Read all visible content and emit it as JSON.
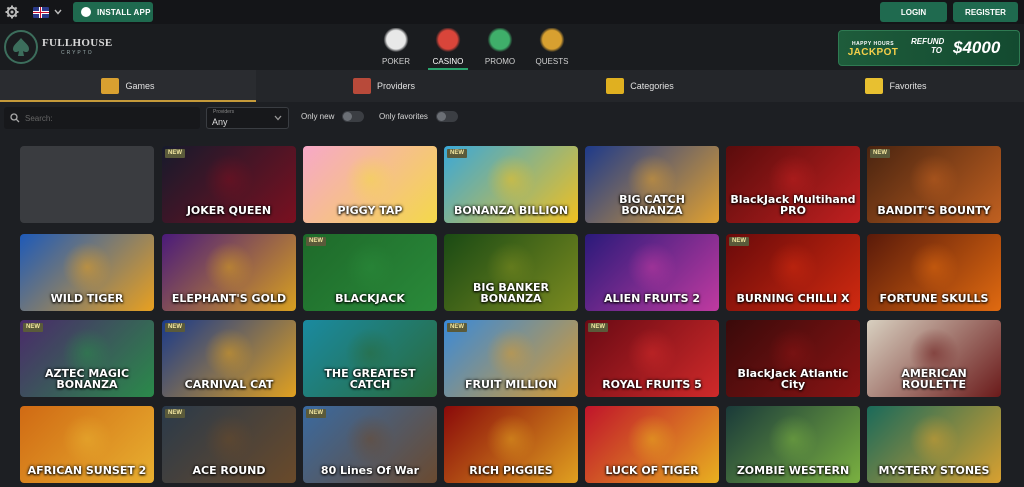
{
  "topbar": {
    "install_label": "INSTALL APP",
    "login_label": "LOGIN",
    "register_label": "REGISTER"
  },
  "logo": {
    "name": "FULLHOUSE",
    "sub": "CRYPTO"
  },
  "nav": [
    {
      "label": "POKER",
      "active": false,
      "color": "#e8e8e8"
    },
    {
      "label": "CASINO",
      "active": true,
      "color": "#d9453a"
    },
    {
      "label": "PROMO",
      "active": false,
      "color": "#3fae6a"
    },
    {
      "label": "QUESTS",
      "active": false,
      "color": "#d8a030"
    }
  ],
  "jackpot": {
    "small": "HAPPY HOURS",
    "big": "JACKPOT",
    "refund": "REFUND",
    "to": "TO",
    "amount": "$4000"
  },
  "tabs": [
    {
      "label": "Games",
      "active": true,
      "icon_color": "#d8a030"
    },
    {
      "label": "Providers",
      "active": false,
      "icon_color": "#b84a3a"
    },
    {
      "label": "Categories",
      "active": false,
      "icon_color": "#e0b020"
    },
    {
      "label": "Favorites",
      "active": false,
      "icon_color": "#e8c030"
    }
  ],
  "filters": {
    "search_placeholder": "Search:",
    "provider_label": "Providers",
    "provider_value": "Any",
    "only_new_label": "Only new",
    "only_favorites_label": "Only favorites"
  },
  "badge_text": "NEW",
  "games": [
    {
      "title": "",
      "is_new": false,
      "bg1": "#3a3c40",
      "bg2": "#3a3c40"
    },
    {
      "title": "JOKER QUEEN",
      "is_new": true,
      "bg1": "#161a2c",
      "bg2": "#7a1020"
    },
    {
      "title": "PIGGY TAP",
      "is_new": false,
      "bg1": "#f7a8c8",
      "bg2": "#f4d84a"
    },
    {
      "title": "BONANZA BILLION",
      "is_new": true,
      "bg1": "#3aa8d8",
      "bg2": "#f0c020"
    },
    {
      "title": "BIG CATCH BONANZA",
      "is_new": false,
      "bg1": "#1e3a8a",
      "bg2": "#e0a030"
    },
    {
      "title": "BlackJack Multihand PRO",
      "is_new": false,
      "bg1": "#5a0c0c",
      "bg2": "#c02020"
    },
    {
      "title": "BANDIT'S BOUNTY",
      "is_new": true,
      "bg1": "#4a2410",
      "bg2": "#c06020"
    },
    {
      "title": "WILD TIGER",
      "is_new": false,
      "bg1": "#1e5ab8",
      "bg2": "#e8a020"
    },
    {
      "title": "ELEPHANT'S GOLD",
      "is_new": false,
      "bg1": "#4a1a7a",
      "bg2": "#d8a020"
    },
    {
      "title": "BLACKJACK",
      "is_new": true,
      "bg1": "#1e6a2a",
      "bg2": "#2a8a3a"
    },
    {
      "title": "BIG BANKER BONANZA",
      "is_new": false,
      "bg1": "#1a4a14",
      "bg2": "#7a8a20"
    },
    {
      "title": "ALIEN FRUITS 2",
      "is_new": false,
      "bg1": "#2a1a7a",
      "bg2": "#c03aa0"
    },
    {
      "title": "BURNING CHILLI X",
      "is_new": true,
      "bg1": "#6a0a0a",
      "bg2": "#d02a10"
    },
    {
      "title": "FORTUNE SKULLS",
      "is_new": false,
      "bg1": "#5a1a0a",
      "bg2": "#e06a10"
    },
    {
      "title": "AZTEC MAGIC BONANZA",
      "is_new": true,
      "bg1": "#4a2a6a",
      "bg2": "#2a8a4a"
    },
    {
      "title": "CARNIVAL CAT",
      "is_new": true,
      "bg1": "#1a3a8a",
      "bg2": "#e0a020"
    },
    {
      "title": "THE GREATEST CATCH",
      "is_new": false,
      "bg1": "#1a8aa0",
      "bg2": "#2a6a3a"
    },
    {
      "title": "FRUIT MILLION",
      "is_new": true,
      "bg1": "#3a8ad8",
      "bg2": "#d89a30"
    },
    {
      "title": "ROYAL FRUITS 5",
      "is_new": true,
      "bg1": "#6a0a14",
      "bg2": "#d02a2a"
    },
    {
      "title": "BlackJack Atlantic City",
      "is_new": false,
      "bg1": "#3a0a0a",
      "bg2": "#8a1414"
    },
    {
      "title": "AMERICAN ROULETTE",
      "is_new": false,
      "bg1": "#d8d0c0",
      "bg2": "#6a1a1a"
    },
    {
      "title": "AFRICAN SUNSET 2",
      "is_new": false,
      "bg1": "#d06a14",
      "bg2": "#e8b030"
    },
    {
      "title": "ACE ROUND",
      "is_new": true,
      "bg1": "#2a3a4a",
      "bg2": "#6a4a2a"
    },
    {
      "title": "80 Lines Of War",
      "is_new": true,
      "bg1": "#3a6aa0",
      "bg2": "#6a4a30"
    },
    {
      "title": "RICH PIGGIES",
      "is_new": false,
      "bg1": "#8a0a0a",
      "bg2": "#e0a020"
    },
    {
      "title": "LUCK OF TIGER",
      "is_new": false,
      "bg1": "#c0142a",
      "bg2": "#e8b020"
    },
    {
      "title": "ZOMBIE WESTERN",
      "is_new": false,
      "bg1": "#1a3a3a",
      "bg2": "#7ab040"
    },
    {
      "title": "MYSTERY STONES",
      "is_new": false,
      "bg1": "#1a6a5a",
      "bg2": "#d8a030"
    }
  ]
}
